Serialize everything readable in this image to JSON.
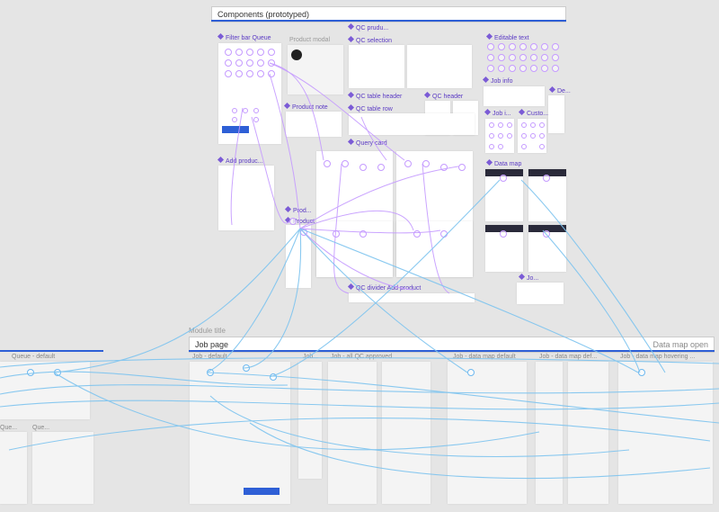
{
  "module_title": "Module title",
  "sections": {
    "components": {
      "title": "Components (prototyped)"
    },
    "job_page": {
      "title": "Job page",
      "right_label": "Data map open"
    }
  },
  "components": {
    "filter_bar_queue": "Filter bar Queue",
    "product_modal": "Product modal",
    "qc_prudu": "QC prudu...",
    "qc_selection": "QC selection",
    "editable_text": "Editable text",
    "job_info": "Job info",
    "qc_table_header": "QC table header",
    "qc_header": "QC header",
    "product_note": "Product note",
    "qc_table_row": "QC table row",
    "job_i": "Job i...",
    "custo": "Custo...",
    "de": "De...",
    "query_card": "Query card",
    "add_produc": "Add produc...",
    "data_map": "Data map",
    "prod": "Prod...",
    "product_ellipsis": "Product ...",
    "qc_divider_add_product": "QC divider Add product",
    "jo": "Jo..."
  },
  "frames": {
    "queue_default": "Queue - default",
    "que1": "Que...",
    "que2": "Que...",
    "job_default": "Job - default",
    "job_ellipsis": "Job...",
    "job_all_qc_approved": "Job - all QC approved",
    "job_data_map_default": "Job - data map default",
    "job_data_map_def": "Job - data map def...",
    "job_data_map_hovering": "Job - data map hovering ..."
  }
}
